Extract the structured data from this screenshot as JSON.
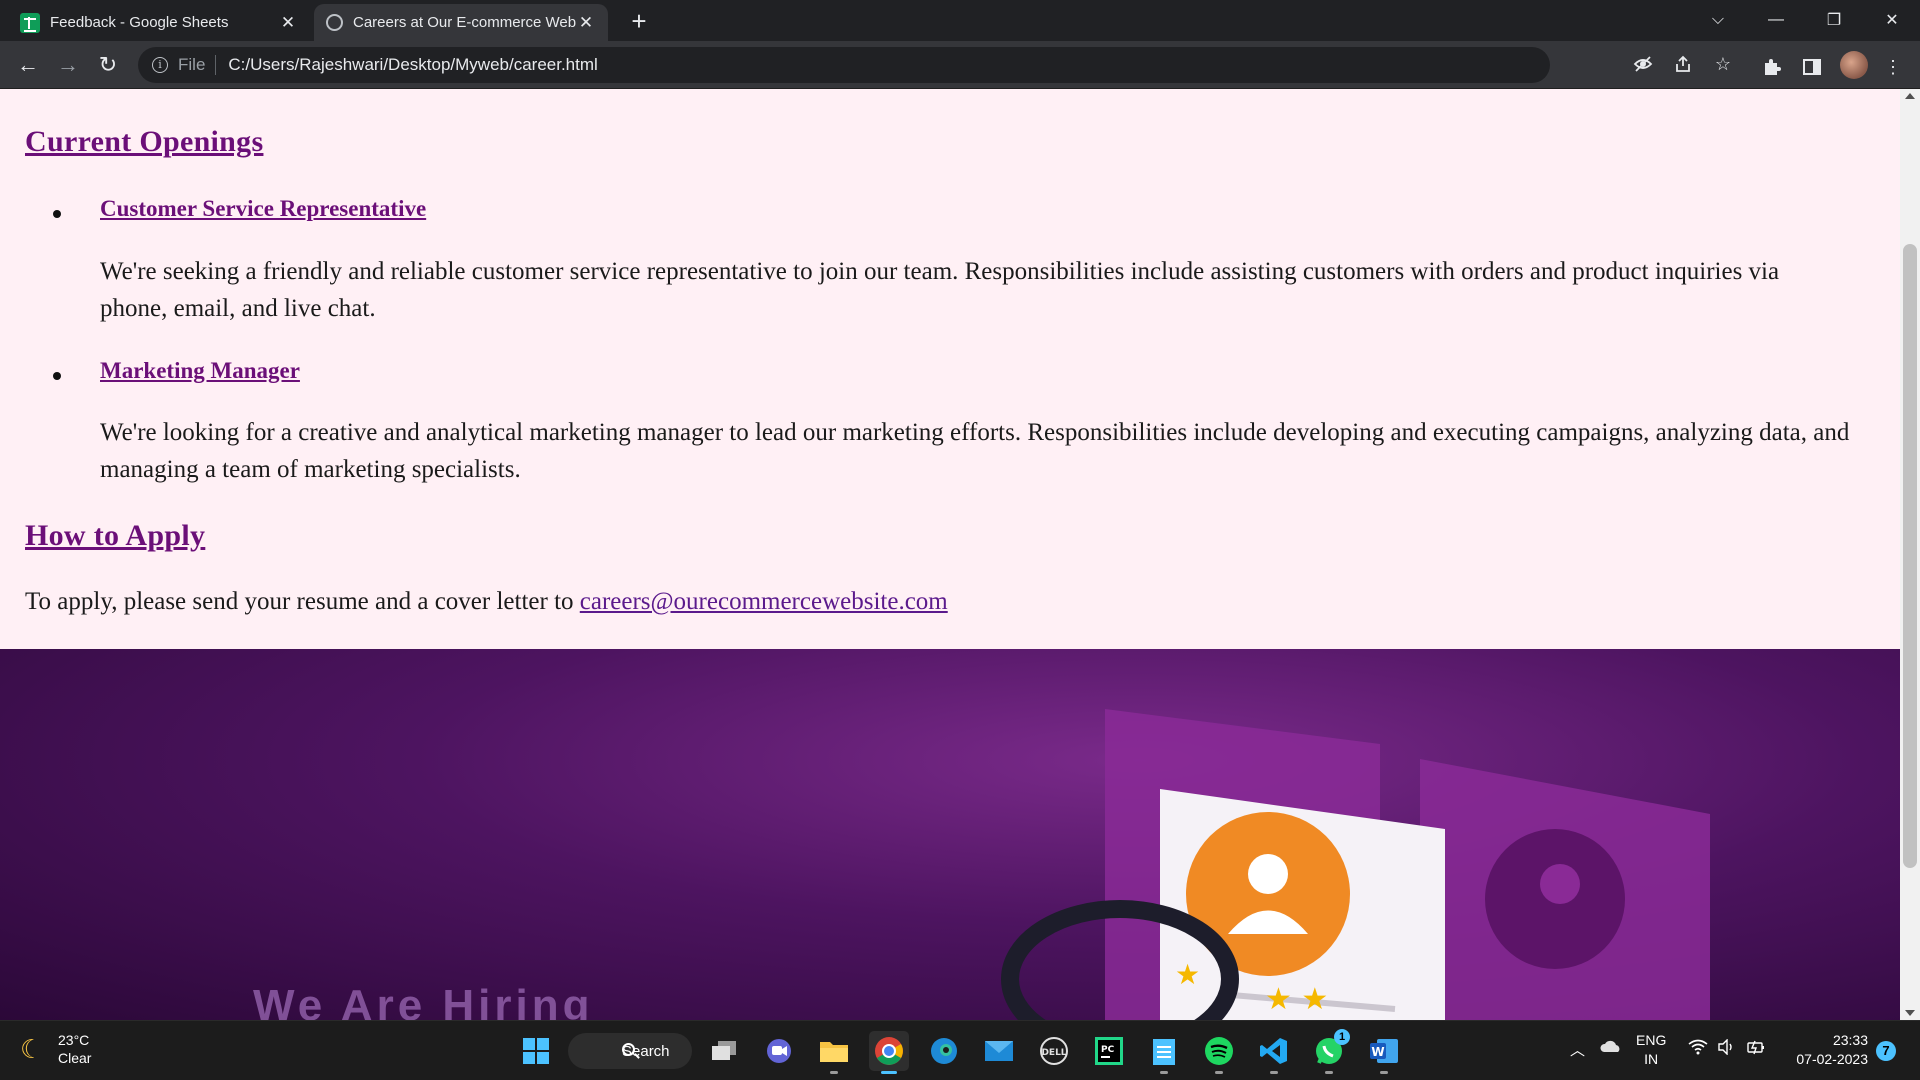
{
  "browser": {
    "tabs": [
      {
        "title": "Feedback - Google Sheets",
        "icon": "google-sheets-icon"
      },
      {
        "title": "Careers at Our E-commerce Web",
        "icon": "globe-icon"
      }
    ],
    "new_tab_glyph": "+",
    "address": {
      "scheme": "File",
      "url": "C:/Users/Rajeshwari/Desktop/Myweb/career.html"
    },
    "window_controls": {
      "dropdown": "⌵",
      "minimize": "—",
      "restore": "❐",
      "close": "✕"
    }
  },
  "page": {
    "openings_heading": "Current Openings",
    "jobs": [
      {
        "title": "Customer Service Representative",
        "description": "We're seeking a friendly and reliable customer service representative to join our team. Responsibilities include assisting customers with orders and product inquiries via phone, email, and live chat."
      },
      {
        "title": "Marketing Manager",
        "description": "We're looking for a creative and analytical marketing manager to lead our marketing efforts. Responsibilities include developing and executing campaigns, analyzing data, and managing a team of marketing specialists."
      }
    ],
    "apply_heading": "How to Apply",
    "apply_text": "To apply, please send your resume and a cover letter to ",
    "apply_email": "careers@ourecommercewebsite.com",
    "banner_text": "We Are Hiring"
  },
  "taskbar": {
    "weather": {
      "temp": "23°C",
      "condition": "Clear"
    },
    "search_label": "Search",
    "language": {
      "line1": "ENG",
      "line2": "IN"
    },
    "time": "23:33",
    "date": "07-02-2023",
    "notification_count": "7",
    "whatsapp_badge": "1"
  },
  "colors": {
    "page_background": "#fff0f5",
    "heading_link": "#6b0f78",
    "banner": "#4d1460",
    "accent": "#4cc2ff"
  }
}
